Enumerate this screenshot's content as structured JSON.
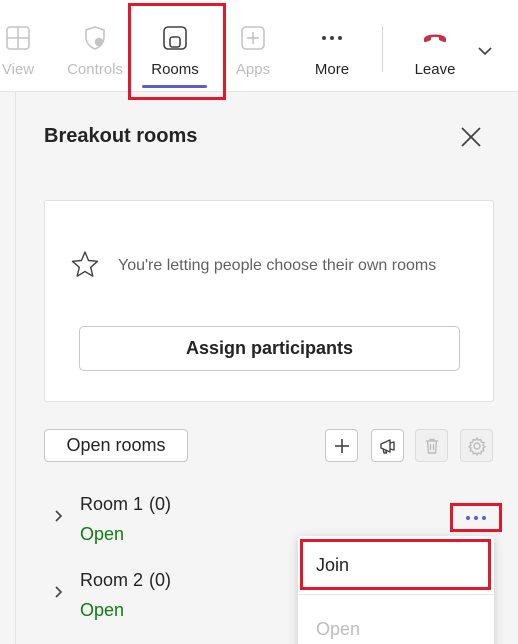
{
  "toolbar": {
    "items": [
      {
        "label": "View",
        "icon": "grid-icon",
        "state": "disabled"
      },
      {
        "label": "Controls",
        "icon": "shield-gear-icon",
        "state": "disabled"
      },
      {
        "label": "Rooms",
        "icon": "breakout-rooms-icon",
        "state": "active"
      },
      {
        "label": "Apps",
        "icon": "add-app-icon",
        "state": "disabled"
      },
      {
        "label": "More",
        "icon": "more-horizontal-icon",
        "state": "normal"
      },
      {
        "label": "Leave",
        "icon": "hang-up-icon",
        "state": "normal"
      }
    ],
    "leave_color": "#c4314b",
    "active_underline_color": "#5b5fc7"
  },
  "panel": {
    "title": "Breakout rooms",
    "info_text": "You're letting people choose their own rooms",
    "assign_label": "Assign participants",
    "open_rooms_label": "Open rooms",
    "rooms": [
      {
        "name": "Room 1",
        "count": "(0)",
        "status": "Open"
      },
      {
        "name": "Room 2",
        "count": "(0)",
        "status": "Open"
      }
    ],
    "status_color": "#107c10"
  },
  "context_menu": {
    "items": [
      {
        "label": "Join",
        "state": "enabled"
      },
      {
        "label": "Open",
        "state": "disabled"
      }
    ]
  },
  "highlight_color": "#e3182d"
}
